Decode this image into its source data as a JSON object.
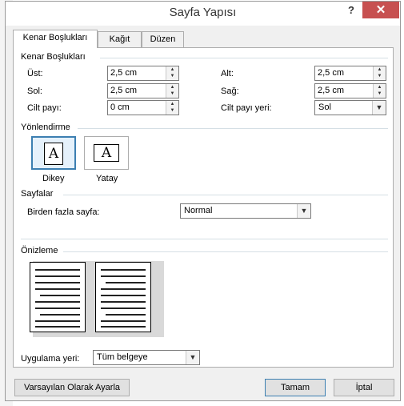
{
  "dialog": {
    "title": "Sayfa Yapısı",
    "help_label": "?",
    "close_label": "✕"
  },
  "tabs": [
    {
      "label": "Kenar Boşlukları",
      "active": true
    },
    {
      "label": "Kağıt",
      "active": false
    },
    {
      "label": "Düzen",
      "active": false
    }
  ],
  "margins": {
    "heading": "Kenar Boşlukları",
    "top_label": "Üst:",
    "top_value": "2,5 cm",
    "bottom_label": "Alt:",
    "bottom_value": "2,5 cm",
    "left_label": "Sol:",
    "left_value": "2,5 cm",
    "right_label": "Sağ:",
    "right_value": "2,5 cm",
    "gutter_label": "Cilt payı:",
    "gutter_value": "0 cm",
    "gutter_pos_label": "Cilt payı yeri:",
    "gutter_pos_value": "Sol"
  },
  "orientation": {
    "heading": "Yönlendirme",
    "portrait_label": "Dikey",
    "landscape_label": "Yatay",
    "icon_letter": "A",
    "selected": "portrait"
  },
  "pages": {
    "heading": "Sayfalar",
    "multiple_label": "Birden fazla sayfa:",
    "multiple_value": "Normal"
  },
  "preview": {
    "heading": "Önizleme"
  },
  "apply": {
    "label": "Uygulama yeri:",
    "value": "Tüm belgeye"
  },
  "buttons": {
    "default_label": "Varsayılan Olarak Ayarla",
    "ok_label": "Tamam",
    "cancel_label": "İptal"
  },
  "colors": {
    "close_button": "#c75050",
    "selection_border": "#3c7fb1",
    "window_bg": "#f0f0f0"
  }
}
